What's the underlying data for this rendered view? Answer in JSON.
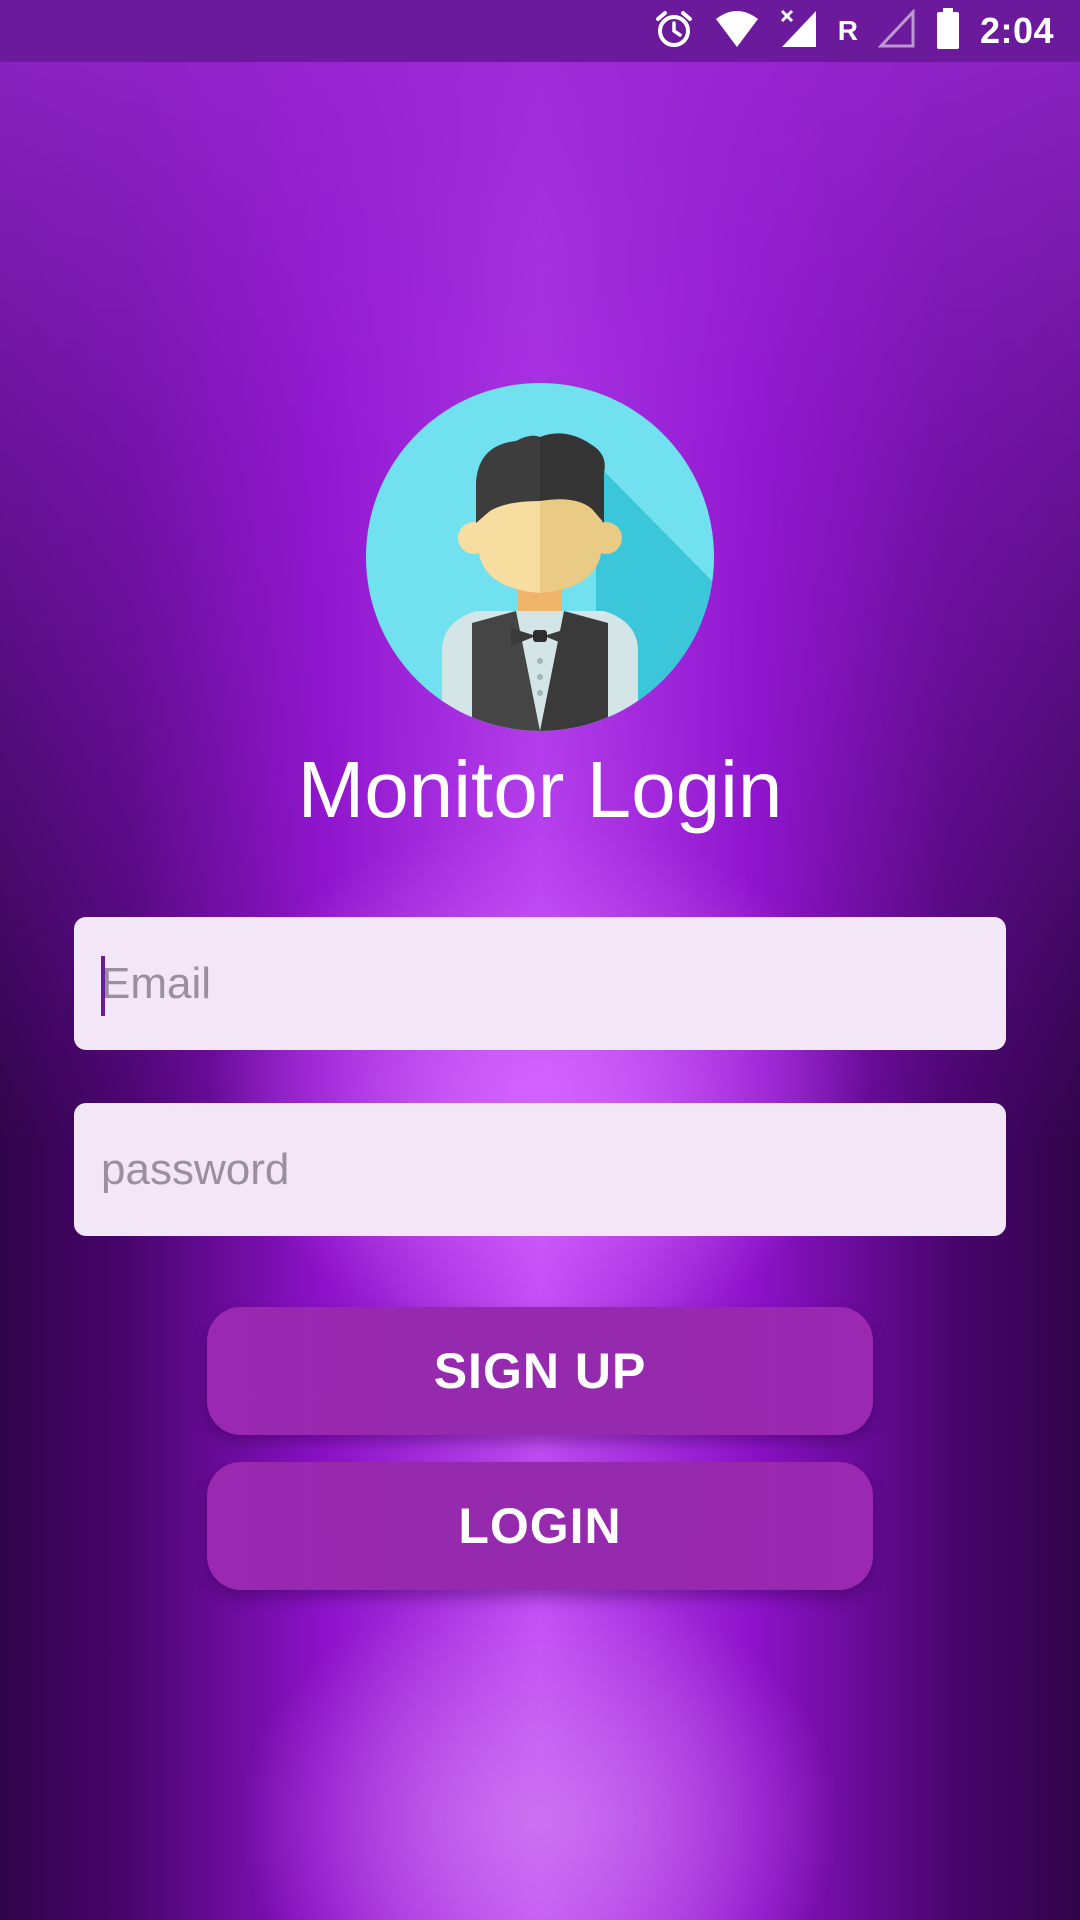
{
  "status_bar": {
    "time": "2:04",
    "roaming": "R",
    "icons": [
      "alarm-icon",
      "wifi-icon",
      "mobile-signal-icon",
      "roaming-indicator",
      "no-signal-icon",
      "battery-icon"
    ]
  },
  "avatar": {
    "icon": "waiter-avatar-icon"
  },
  "title": "Monitor Login",
  "form": {
    "email_placeholder": "Email",
    "email_value": "",
    "password_placeholder": "password",
    "password_value": ""
  },
  "buttons": {
    "signup_label": "SIGN UP",
    "login_label": "LOGIN"
  },
  "colors": {
    "statusbar": "#6a1a9a",
    "button": "#9a28b0",
    "field_bg": "#f3e6f6",
    "avatar_bg": "#70dfee"
  }
}
